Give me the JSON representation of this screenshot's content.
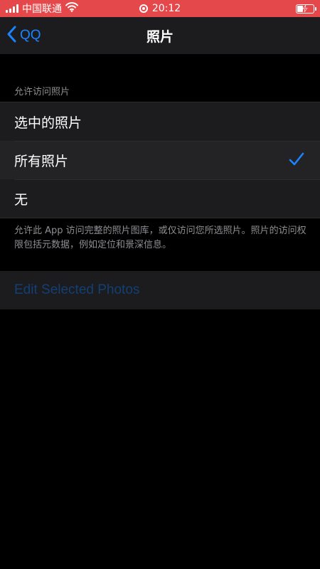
{
  "status_bar": {
    "carrier": "中国联通",
    "time": "20:12"
  },
  "nav": {
    "back_label": "QQ",
    "title": "照片"
  },
  "section_header": "允许访问照片",
  "options": [
    {
      "label": "选中的照片",
      "selected": false
    },
    {
      "label": "所有照片",
      "selected": true
    },
    {
      "label": "无",
      "selected": false
    }
  ],
  "footer_note": "允许此 App 访问完整的照片图库，或仅访问您所选照片。照片的访问权限包括元数据，例如定位和景深信息。",
  "edit_button_label": "Edit Selected Photos",
  "colors": {
    "status_bar_bg": "#e5484a",
    "accent": "#1a84ff",
    "disabled_link": "#123f75",
    "cell_bg": "#1c1c1e",
    "background": "#000000"
  },
  "icons": {
    "back": "chevron-left-icon",
    "check": "checkmark-icon",
    "signal": "signal-icon",
    "wifi": "wifi-icon",
    "record": "screen-record-icon",
    "battery": "battery-charging-icon"
  }
}
